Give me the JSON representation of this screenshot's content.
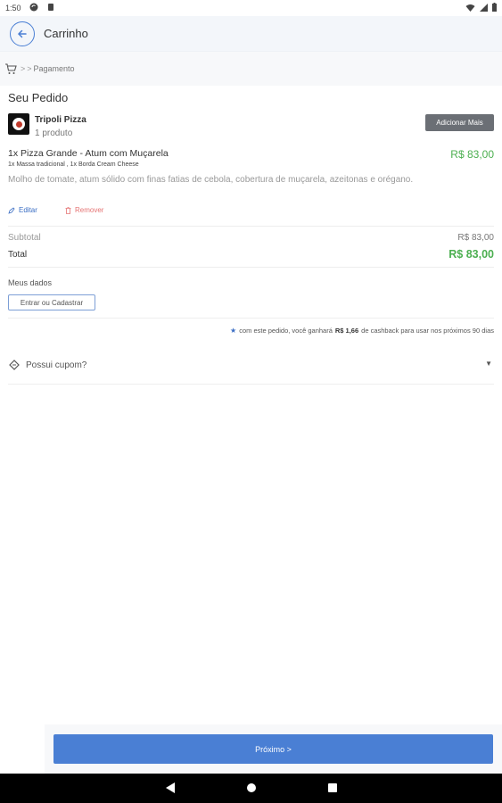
{
  "status_bar": {
    "time": "1:50"
  },
  "app_bar": {
    "title": "Carrinho"
  },
  "breadcrumb": {
    "separator_1": ">",
    "separator_2": ">",
    "current": "Pagamento"
  },
  "order": {
    "section_title": "Seu Pedido",
    "store": {
      "name": "Tripoli Pizza",
      "product_count": "1 produto",
      "add_more_label": "Adicionar Mais"
    },
    "item": {
      "name": "1x Pizza Grande - Atum com Muçarela",
      "price": "R$ 83,00",
      "options": "1x Massa tradicional , 1x Borda Cream Cheese",
      "description": "Molho de tomate, atum sólido com finas fatias de cebola, cobertura de muçarela, azeitonas e orégano.",
      "edit_label": "Editar",
      "remove_label": "Remover"
    },
    "subtotal_label": "Subtotal",
    "subtotal_value": "R$ 83,00",
    "total_label": "Total",
    "total_value": "R$ 83,00"
  },
  "my_data": {
    "title": "Meus dados",
    "login_label": "Entrar ou Cadastrar"
  },
  "cashback": {
    "prefix": "com este pedido, você ganhará",
    "amount": "R$ 1,66",
    "suffix": "de cashback para usar nos próximos 90 dias"
  },
  "coupon": {
    "label": "Possui cupom?"
  },
  "footer": {
    "next_label": "Próximo >"
  },
  "colors": {
    "accent": "#4a7fd4",
    "price_green": "#4caf50",
    "remove_red": "#e57373"
  }
}
